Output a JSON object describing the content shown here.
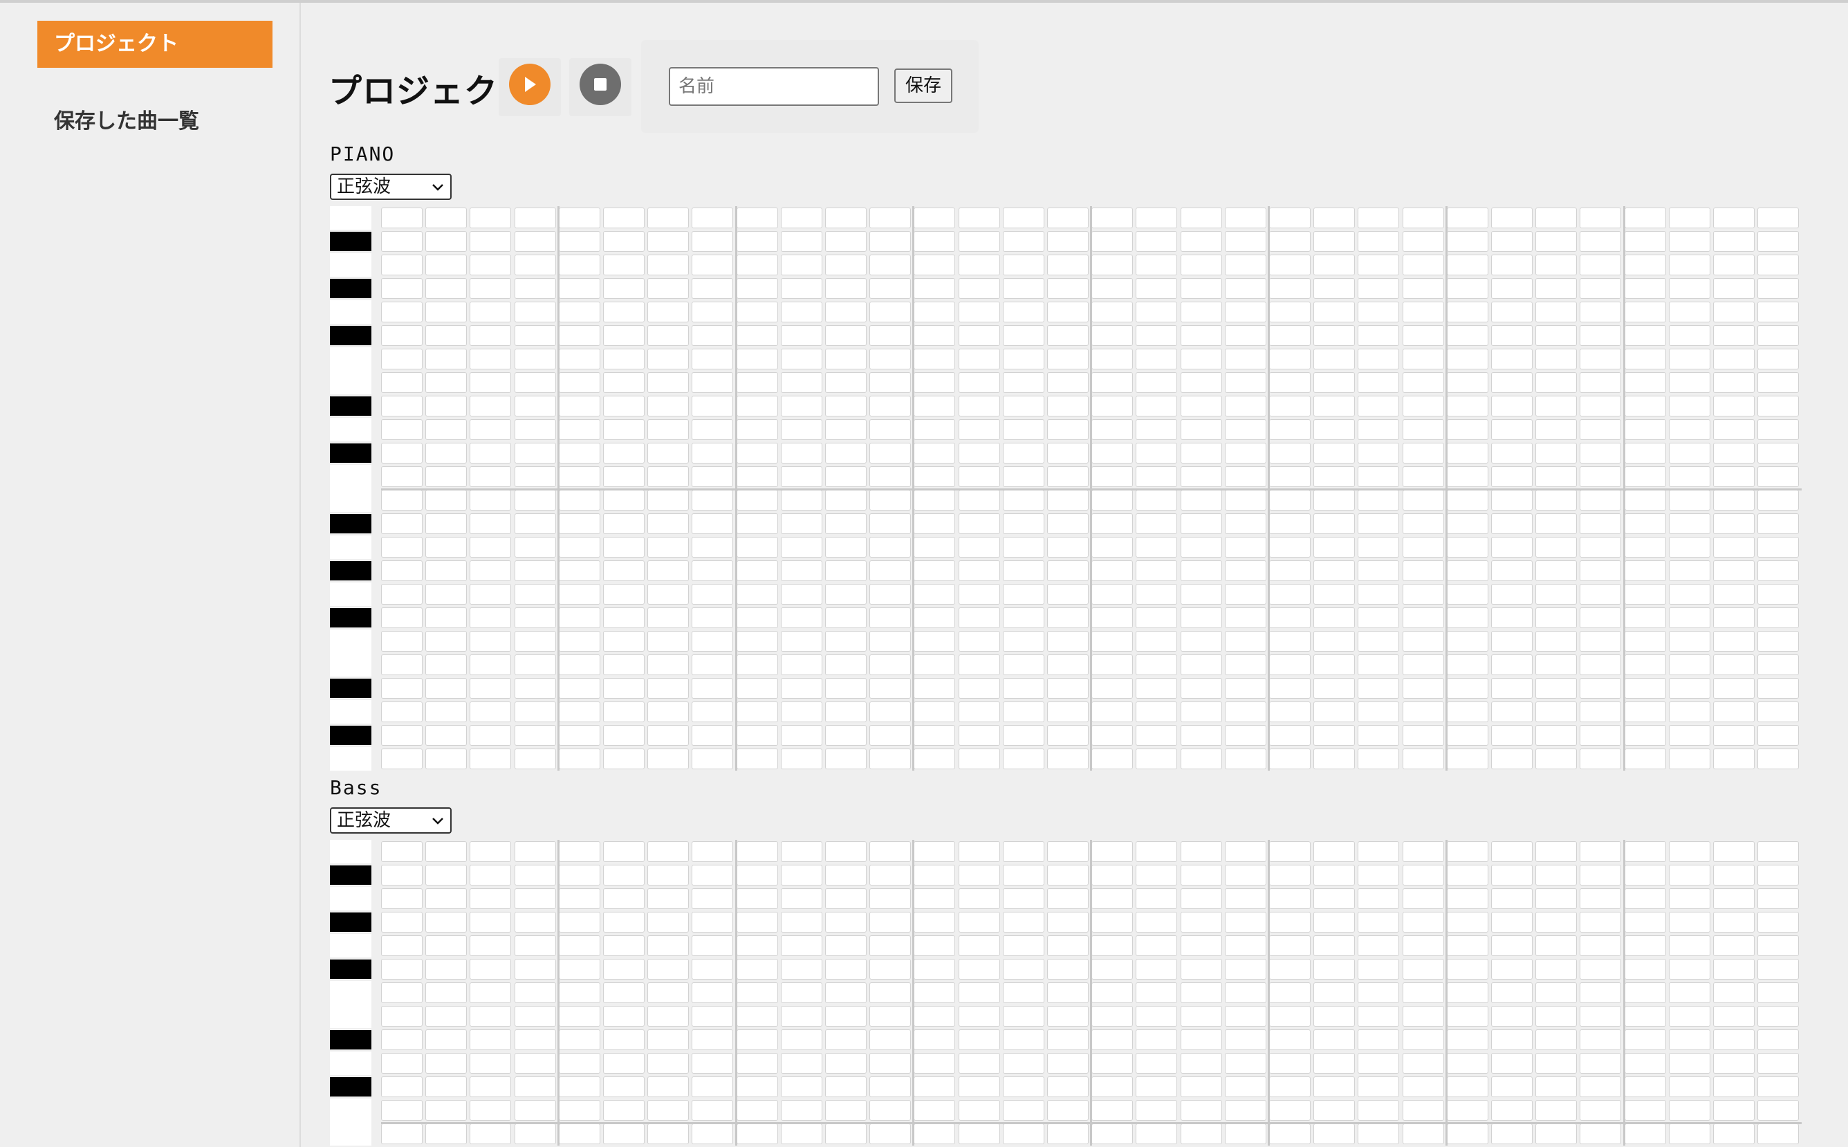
{
  "sidebar": {
    "items": [
      {
        "label": "プロジェクト",
        "active": true
      },
      {
        "label": "保存した曲一覧",
        "active": false
      }
    ]
  },
  "header": {
    "title": "プロジェクト",
    "play_icon": "play-icon",
    "stop_icon": "stop-icon",
    "name_placeholder": "名前",
    "name_value": "",
    "save_label": "保存"
  },
  "tracks": [
    {
      "label": "PIANO",
      "wave": "正弦波"
    },
    {
      "label": "Bass",
      "wave": "正弦波"
    }
  ],
  "colors": {
    "accent": "#f08a2a",
    "stop": "#6e6e6e",
    "background": "#efefef"
  }
}
